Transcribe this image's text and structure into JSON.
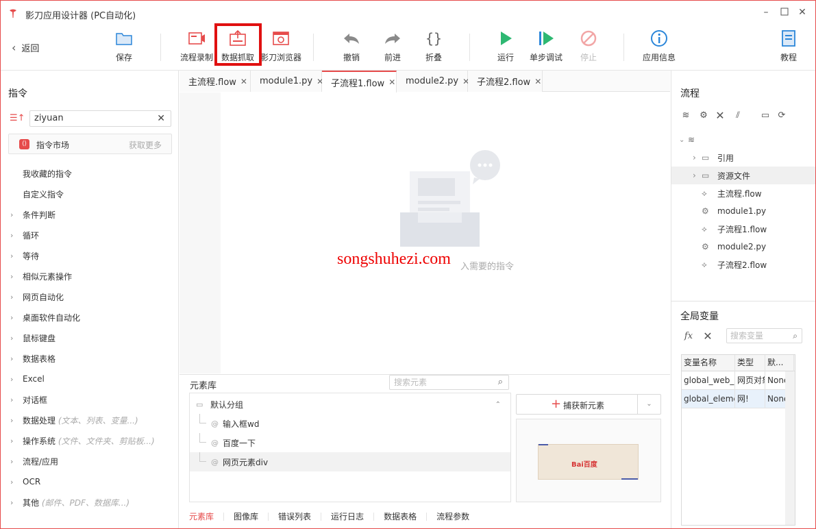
{
  "window": {
    "title": "影刀应用设计器 (PC自动化)",
    "controls": [
      "minimize",
      "maximize",
      "close"
    ]
  },
  "toolbar": {
    "back_label": "返回",
    "save_label": "保存",
    "record_label": "流程录制",
    "scrape_label": "数据抓取",
    "browser_label": "影刀浏览器",
    "undo_label": "撤销",
    "redo_label": "前进",
    "fold_label": "折叠",
    "run_label": "运行",
    "step_label": "单步调试",
    "stop_label": "停止",
    "appinfo_label": "应用信息",
    "tutorial_label": "教程"
  },
  "left_panel": {
    "title": "指令",
    "search_value": "ziyuan",
    "market_label": "指令市场",
    "market_more": "获取更多",
    "items": [
      {
        "label": "我收藏的指令",
        "hint": "",
        "expandable": false
      },
      {
        "label": "自定义指令",
        "hint": "",
        "expandable": false
      },
      {
        "label": "条件判断",
        "hint": "",
        "expandable": true
      },
      {
        "label": "循环",
        "hint": "",
        "expandable": true
      },
      {
        "label": "等待",
        "hint": "",
        "expandable": true
      },
      {
        "label": "相似元素操作",
        "hint": "",
        "expandable": true
      },
      {
        "label": "网页自动化",
        "hint": "",
        "expandable": true
      },
      {
        "label": "桌面软件自动化",
        "hint": "",
        "expandable": true
      },
      {
        "label": "鼠标键盘",
        "hint": "",
        "expandable": true
      },
      {
        "label": "数据表格",
        "hint": "",
        "expandable": true
      },
      {
        "label": "Excel",
        "hint": "",
        "expandable": true
      },
      {
        "label": "对话框",
        "hint": "",
        "expandable": true
      },
      {
        "label": "数据处理",
        "hint": "(文本、列表、变量...)",
        "expandable": true
      },
      {
        "label": "操作系统",
        "hint": "(文件、文件夹、剪贴板...)",
        "expandable": true
      },
      {
        "label": "流程/应用",
        "hint": "",
        "expandable": true
      },
      {
        "label": "OCR",
        "hint": "",
        "expandable": true
      },
      {
        "label": "其他",
        "hint": "(邮件、PDF、数据库...)",
        "expandable": true
      }
    ]
  },
  "editor": {
    "tabs": [
      {
        "label": "主流程.flow",
        "active": false
      },
      {
        "label": "module1.py",
        "active": false
      },
      {
        "label": "子流程1.flow",
        "active": true
      },
      {
        "label": "module2.py",
        "active": false
      },
      {
        "label": "子流程2.flow",
        "active": false
      }
    ],
    "empty_hint_suffix": "入需要的指令",
    "watermark": "songshuhezi.com"
  },
  "element_library": {
    "title": "元素库",
    "search_placeholder": "搜索元素",
    "group_label": "默认分组",
    "items": [
      "输入框wd",
      "百度一下",
      "网页元素div"
    ],
    "capture_label": "捕获新元素",
    "preview_logo": "Bai百度",
    "bottom_tabs": [
      "元素库",
      "图像库",
      "错误列表",
      "运行日志",
      "数据表格",
      "流程参数"
    ]
  },
  "right_panel": {
    "flow_title": "流程",
    "flow_tree": [
      {
        "label": "引用",
        "type": "folder",
        "expandable": true
      },
      {
        "label": "资源文件",
        "type": "folder",
        "expandable": true,
        "selected": true
      },
      {
        "label": "主流程.flow",
        "type": "flow"
      },
      {
        "label": "module1.py",
        "type": "python"
      },
      {
        "label": "子流程1.flow",
        "type": "flow"
      },
      {
        "label": "module2.py",
        "type": "python"
      },
      {
        "label": "子流程2.flow",
        "type": "flow"
      }
    ],
    "vars_title": "全局变量",
    "vars_search_placeholder": "搜索变量",
    "vars_columns": [
      "变量名称",
      "类型",
      "默..."
    ],
    "vars_rows": [
      {
        "name": "global_web_p",
        "type": "网页对象",
        "default": "None"
      },
      {
        "name": "global_eleme",
        "type": "网!",
        "default": "None"
      }
    ]
  },
  "colors": {
    "accent": "#e64b4b",
    "run_green": "#2eb872",
    "step_blue": "#2b86d9",
    "info_blue": "#2b86d9",
    "highlight_box": "#e01010"
  }
}
